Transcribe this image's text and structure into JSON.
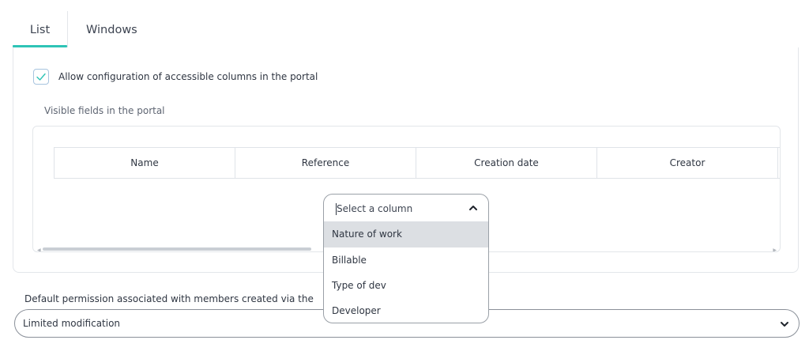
{
  "tabs": [
    {
      "label": "List",
      "active": true
    },
    {
      "label": "Windows",
      "active": false
    }
  ],
  "checkbox": {
    "label": "Allow configuration of accessible columns in the portal",
    "checked": true
  },
  "visible_fields_label": "Visible fields in the portal",
  "table": {
    "columns": [
      "Name",
      "Reference",
      "Creation date",
      "Creator"
    ]
  },
  "column_select": {
    "placeholder": "Select a column",
    "options": [
      "Nature of work",
      "Billable",
      "Type of dev",
      "Developer"
    ],
    "highlighted_option": "Nature of work"
  },
  "permission": {
    "label": "Default permission associated with members created via the",
    "value": "Limited modification"
  },
  "colors": {
    "accent": "#2ec4b6",
    "checkbox_border": "#a7c4df",
    "highlight": "#dcdfe3"
  }
}
